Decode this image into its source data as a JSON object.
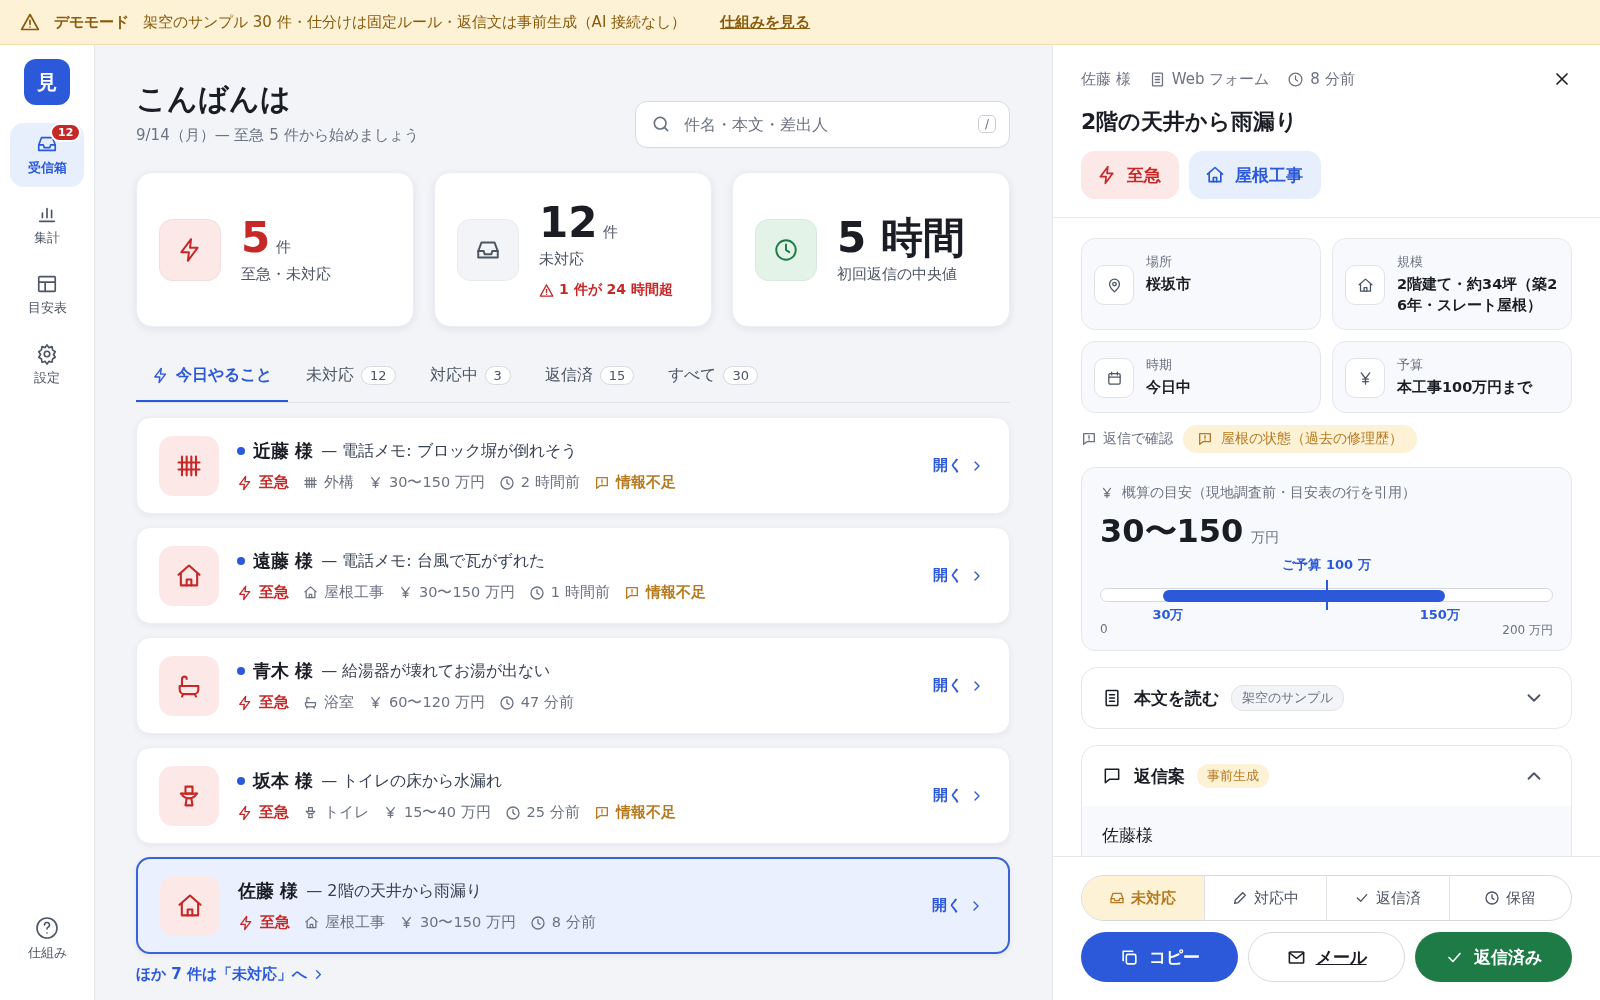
{
  "banner": {
    "label": "デモモード",
    "message": "架空のサンプル 30 件・仕分けは固定ルール・返信文は事前生成（AI 接続なし）",
    "link": "仕組みを見る"
  },
  "sidebar": {
    "logo": "見",
    "items": [
      {
        "kind": "inbox",
        "label": "受信箱",
        "selected": true,
        "badge": "12"
      },
      {
        "kind": "chart",
        "label": "集計",
        "selected": false
      },
      {
        "kind": "table",
        "label": "目安表",
        "selected": false
      },
      {
        "kind": "settings",
        "label": "設定",
        "selected": false
      }
    ],
    "help": {
      "label": "仕組み"
    }
  },
  "greeting": {
    "title": "こんばんは",
    "subtitle": "9/14（月）— 至急 5 件から始めましょう"
  },
  "search": {
    "placeholder": "件名・本文・差出人",
    "shortcut": "/"
  },
  "stats": [
    {
      "kind": "urgent",
      "value": "5",
      "unit": "件",
      "label": "至急・未対応"
    },
    {
      "kind": "open",
      "value": "12",
      "unit": "件",
      "label": "未対応",
      "alert": "1 件が 24 時間超"
    },
    {
      "kind": "time",
      "value": "5 時間",
      "label": "初回返信の中央値"
    }
  ],
  "tabs": [
    {
      "kind": "today",
      "label": "今日やること",
      "selected": true
    },
    {
      "kind": "status",
      "label": "未対応",
      "count": "12",
      "selected": false
    },
    {
      "kind": "status",
      "label": "対応中",
      "count": "3",
      "selected": false
    },
    {
      "kind": "status",
      "label": "返信済",
      "count": "15",
      "selected": false
    },
    {
      "kind": "status",
      "label": "すべて",
      "count": "30",
      "selected": false
    }
  ],
  "inquiries": [
    {
      "kind": "fence",
      "name": "近藤 様",
      "subject": "— 電話メモ: ブロック塀が倒れそう",
      "unread": true,
      "selected": false,
      "priority": "至急",
      "category": "外構",
      "budget": "30〜150 万円",
      "time": "2 時間前",
      "flag": "情報不足",
      "open": "開く"
    },
    {
      "kind": "roof",
      "name": "遠藤 様",
      "subject": "— 電話メモ: 台風で瓦がずれた",
      "unread": true,
      "selected": false,
      "priority": "至急",
      "category": "屋根工事",
      "budget": "30〜150 万円",
      "time": "1 時間前",
      "flag": "情報不足",
      "open": "開く"
    },
    {
      "kind": "bath",
      "name": "青木 様",
      "subject": "— 給湯器が壊れてお湯が出ない",
      "unread": true,
      "selected": false,
      "priority": "至急",
      "category": "浴室",
      "budget": "60〜120 万円",
      "time": "47 分前",
      "open": "開く"
    },
    {
      "kind": "toilet",
      "name": "坂本 様",
      "subject": "— トイレの床から水漏れ",
      "unread": true,
      "selected": false,
      "priority": "至急",
      "category": "トイレ",
      "budget": "15〜40 万円",
      "time": "25 分前",
      "flag": "情報不足",
      "open": "開く"
    },
    {
      "kind": "roof",
      "name": "佐藤 様",
      "subject": "— 2階の天井から雨漏り",
      "unread": false,
      "selected": true,
      "priority": "至急",
      "category": "屋根工事",
      "budget": "30〜150 万円",
      "time": "8 分前",
      "open": "開く"
    }
  ],
  "more_link": "ほか 7 件は「未対応」へ",
  "detail": {
    "sender": "佐藤 様",
    "channel": "Web フォーム",
    "time": "8 分前",
    "title": "2階の天井から雨漏り",
    "tags": [
      {
        "kind": "urgent",
        "label": "至急"
      },
      {
        "kind": "roof",
        "label": "屋根工事"
      }
    ],
    "facts": [
      {
        "kind": "location",
        "label": "場所",
        "value": "桜坂市"
      },
      {
        "kind": "house",
        "label": "規模",
        "value": "2階建て・約34坪（築26年・スレート屋根）"
      },
      {
        "kind": "period",
        "label": "時期",
        "value": "今日中"
      },
      {
        "kind": "budget",
        "label": "予算",
        "value": "本工事100万円まで"
      }
    ],
    "confirm": {
      "label": "返信で確認",
      "items": [
        "屋根の状態（過去の修理歴）"
      ]
    },
    "estimate": {
      "title": "概算の目安（現地調査前・目安表の行を引用）",
      "range": "30〜150",
      "unit": "万円",
      "budget_label": "ご予算 100 万",
      "low_label": "30万",
      "high_label": "150万",
      "axis_min": "0",
      "axis_max": "200 万円",
      "start": {
        "level": 0.15
      },
      "end": {
        "level": 0.75
      },
      "budget": {
        "level": 0.5
      }
    },
    "body": {
      "title": "本文を読む",
      "badge": "架空のサンプル",
      "expanded": false
    },
    "reply": {
      "title": "返信案",
      "badge": "事前生成",
      "expanded": true,
      "text": "佐藤様"
    },
    "status": [
      {
        "kind": "open",
        "label": "未対応",
        "selected": true
      },
      {
        "kind": "progress",
        "label": "対応中",
        "selected": false
      },
      {
        "kind": "done",
        "label": "返信済",
        "selected": false
      },
      {
        "kind": "hold",
        "label": "保留",
        "selected": false
      }
    ],
    "actions": [
      {
        "kind": "copy",
        "label": "コピー"
      },
      {
        "kind": "mail",
        "label": "メール"
      },
      {
        "kind": "done",
        "label": "返信済み"
      }
    ]
  }
}
